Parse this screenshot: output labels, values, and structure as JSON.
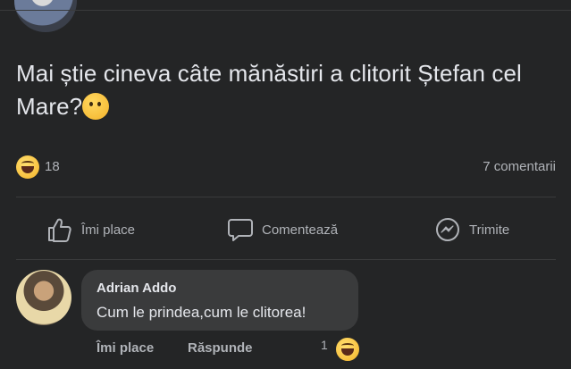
{
  "post": {
    "text": "Mai știe cineva câte mănăstiri a clitorit  Ștefan cel Mare?",
    "emoji_icon": "thinking-face-icon"
  },
  "stats": {
    "reaction_icon": "laughing-emoji-icon",
    "reaction_count": "18",
    "comments": "7 comentarii"
  },
  "actions": {
    "like": "Îmi place",
    "comment": "Comentează",
    "share": "Trimite"
  },
  "comment": {
    "author": "Adrian Addo",
    "text": "Cum le prindea,cum le clitorea!",
    "like": "Îmi place",
    "reply": "Răspunde",
    "reaction_count": "1",
    "reaction_icon": "laughing-emoji-icon"
  },
  "colors": {
    "background": "#242526",
    "bubble": "#3a3b3c",
    "text": "#e4e6eb",
    "secondary_text": "#b0b3b8"
  }
}
